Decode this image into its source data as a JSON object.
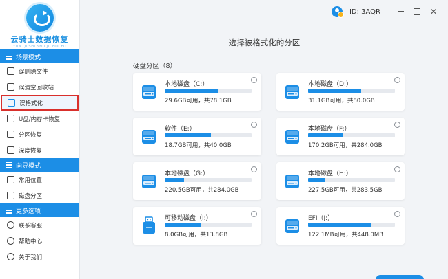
{
  "app": {
    "logo_name": "云骑士数据恢复",
    "logo_sub": "YUN QI SHI SHU JU HUI FU",
    "user_id": "ID: 3AQR"
  },
  "sidebar": {
    "sections": [
      {
        "title": "场景模式",
        "items": [
          {
            "label": "误删除文件",
            "icon": "file-icon"
          },
          {
            "label": "误清空回收站",
            "icon": "recycle-bin-icon"
          },
          {
            "label": "误格式化",
            "icon": "format-drive-icon",
            "active": true
          },
          {
            "label": "U盘/内存卡恢复",
            "icon": "usb-icon"
          },
          {
            "label": "分区恢复",
            "icon": "partition-icon"
          },
          {
            "label": "深度恢复",
            "icon": "deep-scan-icon"
          }
        ]
      },
      {
        "title": "向导模式",
        "items": [
          {
            "label": "常用位置",
            "icon": "location-icon"
          },
          {
            "label": "磁盘分区",
            "icon": "disk-partition-icon"
          }
        ]
      },
      {
        "title": "更多选项",
        "items": [
          {
            "label": "联系客服",
            "icon": "support-icon"
          },
          {
            "label": "帮助中心",
            "icon": "help-icon"
          },
          {
            "label": "关于我们",
            "icon": "info-icon"
          }
        ]
      }
    ]
  },
  "main": {
    "title": "选择被格式化的分区",
    "section_label": "硬盘分区（8）",
    "partitions": [
      {
        "name": "本地磁盘（C:）",
        "size": "29.6GB可用，共78.1GB",
        "used_fraction": 0.62,
        "kind": "hdd"
      },
      {
        "name": "本地磁盘（D:）",
        "size": "31.1GB可用，共80.0GB",
        "used_fraction": 0.61,
        "kind": "hdd"
      },
      {
        "name": "软件（E:）",
        "size": "18.7GB可用，共40.0GB",
        "used_fraction": 0.53,
        "kind": "hdd"
      },
      {
        "name": "本地磁盘（F:）",
        "size": "170.2GB可用，共284.0GB",
        "used_fraction": 0.4,
        "kind": "hdd"
      },
      {
        "name": "本地磁盘（G:）",
        "size": "220.5GB可用，共284.0GB",
        "used_fraction": 0.22,
        "kind": "hdd"
      },
      {
        "name": "本地磁盘（H:）",
        "size": "227.5GB可用，共283.5GB",
        "used_fraction": 0.2,
        "kind": "hdd"
      },
      {
        "name": "可移动磁盘（I:）",
        "size": "8.0GB可用，共13.8GB",
        "used_fraction": 0.42,
        "kind": "usb"
      },
      {
        "name": "EFI（J:）",
        "size": "122.1MB可用，共448.0MB",
        "used_fraction": 0.73,
        "kind": "hdd"
      }
    ]
  },
  "colors": {
    "accent": "#1c8ee6",
    "highlight_border": "#d9302c"
  }
}
